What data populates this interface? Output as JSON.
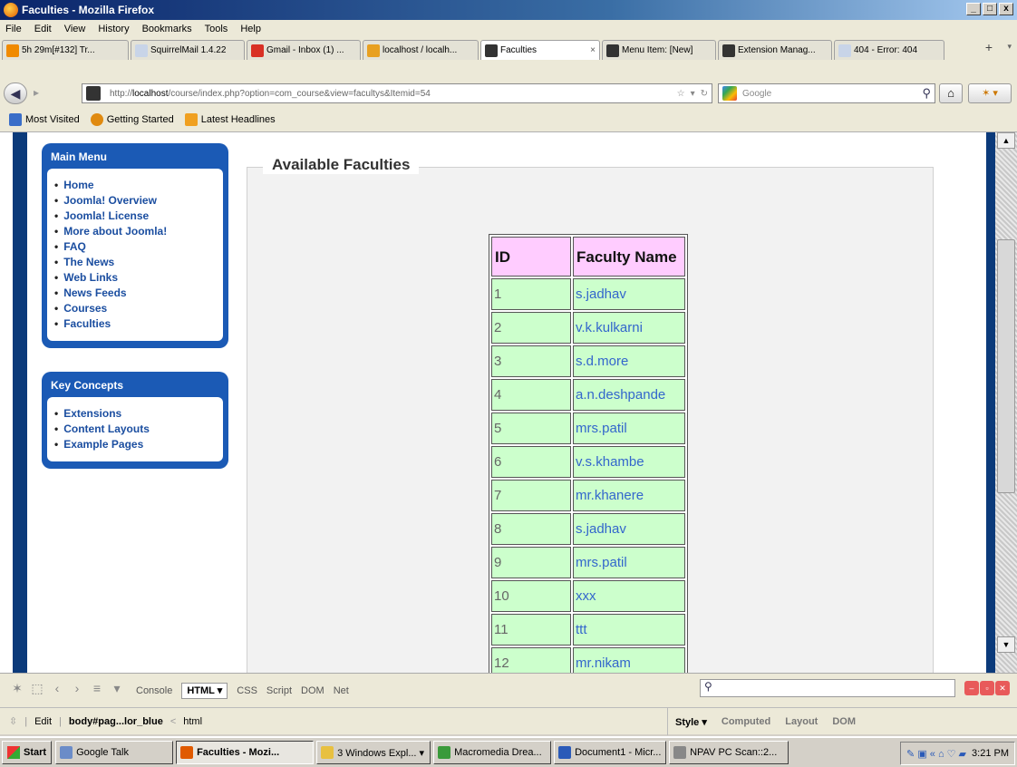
{
  "window": {
    "title": "Faculties - Mozilla Firefox",
    "min": "_",
    "max": "□",
    "close": "x"
  },
  "menu": [
    "File",
    "Edit",
    "View",
    "History",
    "Bookmarks",
    "Tools",
    "Help"
  ],
  "tabs": [
    {
      "label": "5h 29m[#132] Tr...",
      "color": "#f08a00",
      "width": 140
    },
    {
      "label": "SquirrelMail 1.4.22",
      "color": "#c8d4e8",
      "width": 126
    },
    {
      "label": "Gmail - Inbox (1) ...",
      "color": "#d93025",
      "width": 126
    },
    {
      "label": "localhost / localh...",
      "color": "#e8a020",
      "width": 128
    },
    {
      "label": "Faculties",
      "color": "#333333",
      "width": 132,
      "active": true
    },
    {
      "label": "Menu Item: [New]",
      "color": "#333333",
      "width": 126
    },
    {
      "label": "Extension Manag...",
      "color": "#333333",
      "width": 126
    },
    {
      "label": "404 - Error: 404",
      "color": "#c8d4e8",
      "width": 122
    }
  ],
  "url": {
    "prefix": "http://",
    "host": "localhost",
    "path": "/course/index.php?option=com_course&view=facultys&Itemid=54"
  },
  "search": {
    "placeholder": "Google"
  },
  "bookmarks": [
    "Most Visited",
    "Getting Started",
    "Latest Headlines"
  ],
  "mainMenu": {
    "title": "Main Menu",
    "items": [
      "Home",
      "Joomla! Overview",
      "Joomla! License",
      "More about Joomla!",
      "FAQ",
      "The News",
      "Web Links",
      "News Feeds",
      "Courses",
      "Faculties"
    ]
  },
  "keyConcepts": {
    "title": "Key Concepts",
    "items": [
      "Extensions",
      "Content Layouts",
      "Example Pages"
    ]
  },
  "page": {
    "heading": "Available Faculties"
  },
  "table": {
    "headers": [
      "ID",
      "Faculty Name"
    ],
    "rows": [
      [
        "1",
        "s.jadhav"
      ],
      [
        "2",
        "v.k.kulkarni"
      ],
      [
        "3",
        "s.d.more"
      ],
      [
        "4",
        "a.n.deshpande"
      ],
      [
        "5",
        "mrs.patil"
      ],
      [
        "6",
        "v.s.khambe"
      ],
      [
        "7",
        "mr.khanere"
      ],
      [
        "8",
        "s.jadhav"
      ],
      [
        "9",
        "mrs.patil"
      ],
      [
        "10",
        "xxx"
      ],
      [
        "11",
        "ttt"
      ],
      [
        "12",
        "mr.nikam"
      ]
    ]
  },
  "firebug": {
    "tabs": [
      "Console",
      "HTML ▾",
      "CSS",
      "Script",
      "DOM",
      "Net"
    ],
    "active": "HTML ▾",
    "path": {
      "edit": "Edit",
      "node": "body#pag...lor_blue",
      "parent": "html"
    },
    "rightTabs": [
      "Style ▾",
      "Computed",
      "Layout",
      "DOM"
    ]
  },
  "taskbar": {
    "start": "Start",
    "tasks": [
      {
        "label": "Google Talk",
        "color": "#6b8cc8"
      },
      {
        "label": "Faculties - Mozi...",
        "color": "#e05a00",
        "active": true
      },
      {
        "label": "3 Windows Expl... ▾",
        "color": "#e8c040"
      },
      {
        "label": "Macromedia Drea...",
        "color": "#3a9a3a"
      },
      {
        "label": "Document1 - Micr...",
        "color": "#2a5ab8"
      },
      {
        "label": "NPAV PC Scan::2...",
        "color": "#888888"
      }
    ],
    "time": "3:21 PM"
  }
}
